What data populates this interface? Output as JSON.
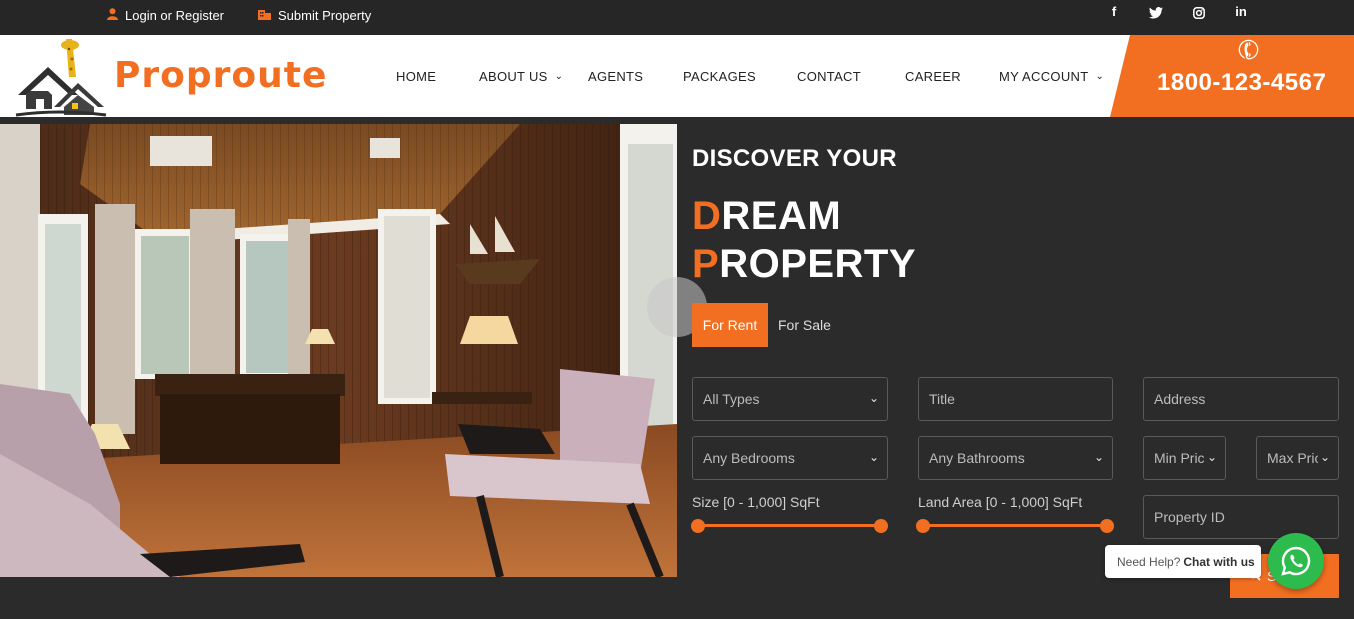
{
  "topbar": {
    "login_label": "Login or Register",
    "submit_label": "Submit Property",
    "social": [
      "f",
      "twitter",
      "instagram",
      "in"
    ]
  },
  "header": {
    "logo_text": "Proproute",
    "nav": [
      {
        "label": "HOME",
        "has_dropdown": false
      },
      {
        "label": "ABOUT US",
        "has_dropdown": true
      },
      {
        "label": "AGENTS",
        "has_dropdown": false
      },
      {
        "label": "PACKAGES",
        "has_dropdown": false
      },
      {
        "label": "CONTACT",
        "has_dropdown": false
      },
      {
        "label": "CAREER",
        "has_dropdown": false
      },
      {
        "label": "MY ACCOUNT",
        "has_dropdown": true
      }
    ],
    "phone": "1800-123-4567"
  },
  "hero": {
    "heading_small": "DISCOVER YOUR",
    "heading_line1_first": "D",
    "heading_line1_rest": "REAM",
    "heading_line2_first": "P",
    "heading_line2_rest": "ROPERTY"
  },
  "search": {
    "tabs": {
      "rent": "For Rent",
      "sale": "For Sale"
    },
    "type_select": "All Types",
    "title_placeholder": "Title",
    "address_placeholder": "Address",
    "bedrooms_select": "Any Bedrooms",
    "bathrooms_select": "Any Bathrooms",
    "min_price_select": "Min Price",
    "max_price_select": "Max Price",
    "size_label": "Size [0 - 1,000] SqFt",
    "land_label": "Land Area [0 - 1,000] SqFt",
    "property_id_placeholder": "Property ID",
    "search_label": "Search"
  },
  "help": {
    "prefix": "Need Help?",
    "bold": "Chat with us"
  },
  "colors": {
    "accent": "#f26f21",
    "dark_bg": "#2b2b2b",
    "whatsapp": "#2dbb4d"
  }
}
